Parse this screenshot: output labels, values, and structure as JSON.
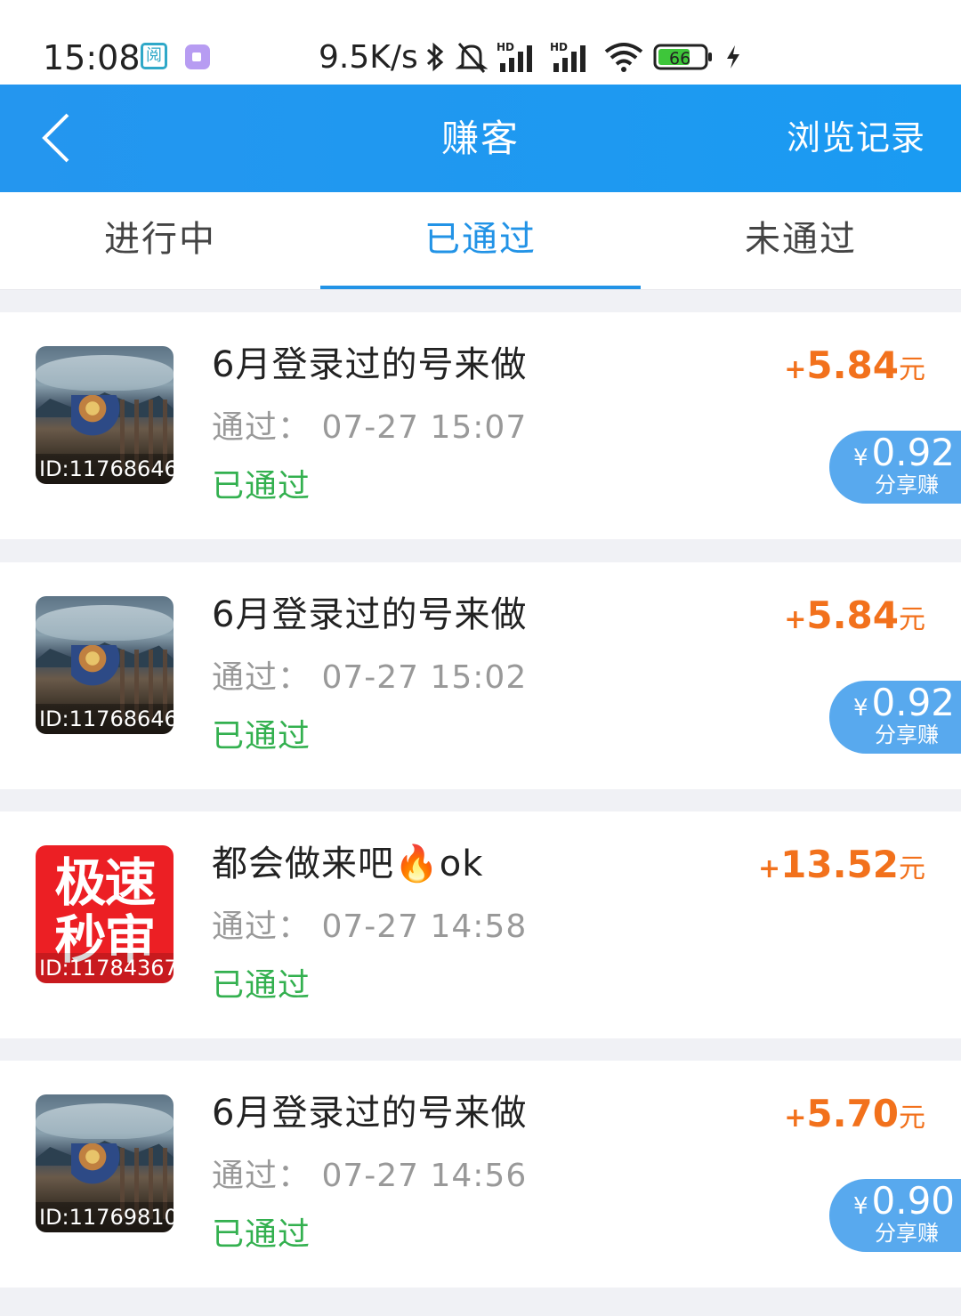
{
  "status_bar": {
    "time": "15:08",
    "network_speed": "9.5K/s",
    "battery": "66",
    "icons": [
      "app-reader-icon",
      "video-app-icon",
      "bluetooth-icon",
      "mute-icon",
      "signal-hd-icon",
      "signal-hd-icon",
      "wifi-icon",
      "battery-icon",
      "charging-icon"
    ]
  },
  "header": {
    "title": "赚客",
    "history_label": "浏览记录"
  },
  "tabs": [
    {
      "label": "进行中"
    },
    {
      "label": "已通过"
    },
    {
      "label": "未通过"
    }
  ],
  "active_tab": 1,
  "tasks": [
    {
      "thumb_type": "photo",
      "thumb_id": "ID:11768646",
      "title": "6月登录过的号来做",
      "time": "通过：  07-27 15:07",
      "status": "已通过",
      "reward_plus": "+",
      "reward_amount": "5.84",
      "reward_unit": "元",
      "share_yen": "¥",
      "share_value": "0.92",
      "share_label": "分享赚"
    },
    {
      "thumb_type": "photo",
      "thumb_id": "ID:11768646",
      "title": "6月登录过的号来做",
      "time": "通过：  07-27 15:02",
      "status": "已通过",
      "reward_plus": "+",
      "reward_amount": "5.84",
      "reward_unit": "元",
      "share_yen": "¥",
      "share_value": "0.92",
      "share_label": "分享赚"
    },
    {
      "thumb_type": "red",
      "thumb_text": "极速秒审",
      "thumb_id": "ID:11784367",
      "title": "都会做来吧🔥ok",
      "time": "通过：  07-27 14:58",
      "status": "已通过",
      "reward_plus": "+",
      "reward_amount": "13.52",
      "reward_unit": "元"
    },
    {
      "thumb_type": "photo",
      "thumb_id": "ID:11769810",
      "title": "6月登录过的号来做",
      "time": "通过：  07-27 14:56",
      "status": "已通过",
      "reward_plus": "+",
      "reward_amount": "5.70",
      "reward_unit": "元",
      "share_yen": "¥",
      "share_value": "0.90",
      "share_label": "分享赚"
    }
  ],
  "colors": {
    "header_blue": "#1a9bf2",
    "active_tab": "#2293e6",
    "reward_orange": "#f2711c",
    "status_green": "#33b04f",
    "share_badge": "#58a9ee"
  }
}
